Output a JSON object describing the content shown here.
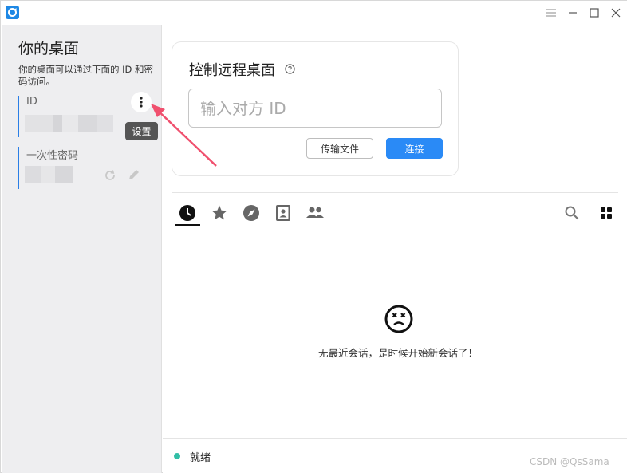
{
  "app": {
    "accent": "#2a8af6"
  },
  "window_controls": [
    "menu-icon",
    "minimize-icon",
    "maximize-icon",
    "close-icon"
  ],
  "sidebar": {
    "title": "你的桌面",
    "description": "你的桌面可以通过下面的 ID 和密码访问。",
    "id_label": "ID",
    "password_label": "一次性密码",
    "menu_tooltip": "设置"
  },
  "connect": {
    "title": "控制远程桌面",
    "input_placeholder": "输入对方 ID",
    "transfer_label": "传输文件",
    "connect_label": "连接"
  },
  "tabs": [
    "recent-sessions-icon",
    "favorites-icon",
    "discovered-icon",
    "address-book-icon",
    "group-icon"
  ],
  "sessions": {
    "empty_text": "无最近会话，是时候开始新会话了！"
  },
  "status": {
    "text": "就绪",
    "color": "#32bea6"
  },
  "watermark": "CSDN @QsSama__"
}
